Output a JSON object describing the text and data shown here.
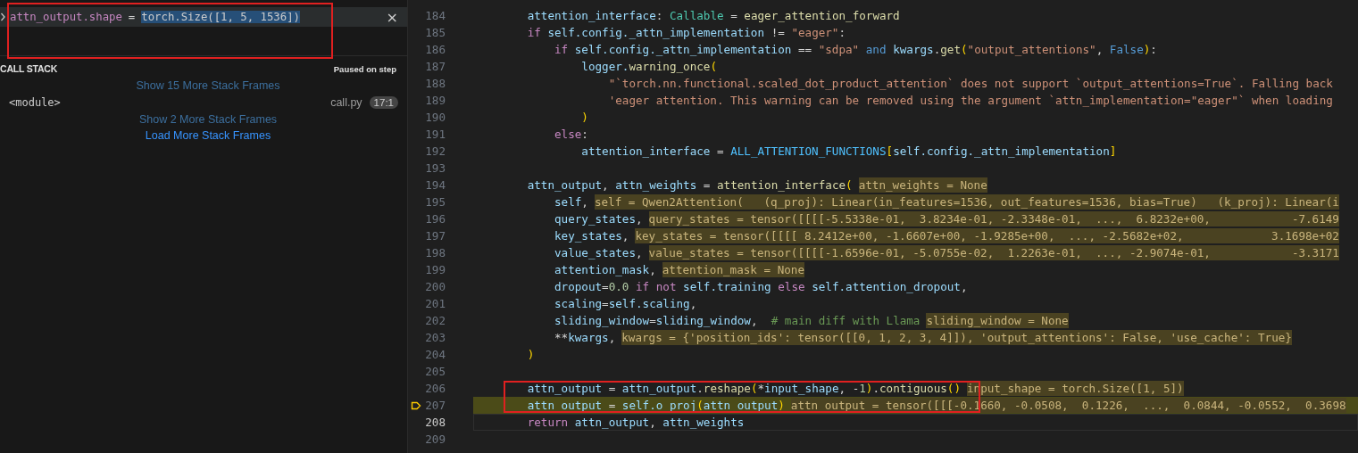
{
  "watch": {
    "expression": "attn_output.shape",
    "operator": "=",
    "value": "torch.Size([1, 5, 1536])",
    "close": "×"
  },
  "call_stack": {
    "title": "CALL STACK",
    "status": "Paused on step",
    "items": [
      {
        "kind": "link",
        "text": "Show 15 More Stack Frames"
      },
      {
        "kind": "frame",
        "name": "<module>",
        "file": "call.py",
        "position": "17:1"
      },
      {
        "kind": "link",
        "text": "Show 2 More Stack Frames"
      },
      {
        "kind": "action",
        "text": "Load More Stack Frames"
      }
    ]
  },
  "editor": {
    "lines": [
      {
        "number": "184",
        "stopped": false,
        "cursor": false,
        "tokens": [
          {
            "kind": "var",
            "text": "        attention_interface"
          },
          {
            "kind": "punct",
            "text": ":"
          },
          {
            "kind": "type",
            "text": " Callable"
          },
          {
            "kind": "punct",
            "text": " ="
          },
          {
            "kind": "func",
            "text": " eager_attention_forward"
          }
        ]
      },
      {
        "number": "185",
        "stopped": false,
        "cursor": false,
        "tokens": [
          {
            "kind": "keyword",
            "text": "        if"
          },
          {
            "kind": "var",
            "text": " self.config._attn_implementation"
          },
          {
            "kind": "punct",
            "text": " !="
          },
          {
            "kind": "string",
            "text": " \"eager\""
          },
          {
            "kind": "punct",
            "text": ":"
          }
        ]
      },
      {
        "number": "186",
        "stopped": false,
        "cursor": false,
        "tokens": [
          {
            "kind": "keyword",
            "text": "            if"
          },
          {
            "kind": "var",
            "text": " self.config._attn_implementation"
          },
          {
            "kind": "punct",
            "text": " =="
          },
          {
            "kind": "string",
            "text": " \"sdpa\""
          },
          {
            "kind": "const",
            "text": " and"
          },
          {
            "kind": "var",
            "text": " kwargs"
          },
          {
            "kind": "punct",
            "text": "."
          },
          {
            "kind": "func",
            "text": "get"
          },
          {
            "kind": "bracket",
            "text": "("
          },
          {
            "kind": "string",
            "text": "\"output_attentions\""
          },
          {
            "kind": "punct",
            "text": ","
          },
          {
            "kind": "const",
            "text": " False"
          },
          {
            "kind": "bracket",
            "text": ")"
          },
          {
            "kind": "punct",
            "text": ":"
          }
        ]
      },
      {
        "number": "187",
        "stopped": false,
        "cursor": false,
        "tokens": [
          {
            "kind": "var",
            "text": "                logger."
          },
          {
            "kind": "func",
            "text": "warning_once"
          },
          {
            "kind": "bracket",
            "text": "("
          }
        ]
      },
      {
        "number": "188",
        "stopped": false,
        "cursor": false,
        "tokens": [
          {
            "kind": "string",
            "text": "                    \"`torch.nn.functional.scaled_dot_product_attention` does not support `output_attentions=True`. Falling back"
          }
        ]
      },
      {
        "number": "189",
        "stopped": false,
        "cursor": false,
        "tokens": [
          {
            "kind": "string",
            "text": "                    'eager attention. This warning can be removed using the argument `attn_implementation=\"eager\"` when loading"
          }
        ]
      },
      {
        "number": "190",
        "stopped": false,
        "cursor": false,
        "tokens": [
          {
            "kind": "bracket",
            "text": "                )"
          }
        ]
      },
      {
        "number": "191",
        "stopped": false,
        "cursor": false,
        "tokens": [
          {
            "kind": "keyword",
            "text": "            else"
          },
          {
            "kind": "punct",
            "text": ":"
          }
        ]
      },
      {
        "number": "192",
        "stopped": false,
        "cursor": false,
        "tokens": [
          {
            "kind": "var",
            "text": "                attention_interface"
          },
          {
            "kind": "punct",
            "text": " ="
          },
          {
            "kind": "constant",
            "text": " ALL_ATTENTION_FUNCTIONS"
          },
          {
            "kind": "bracket",
            "text": "["
          },
          {
            "kind": "var",
            "text": "self.config._attn_implementation"
          },
          {
            "kind": "bracket",
            "text": "]"
          }
        ]
      },
      {
        "number": "193",
        "stopped": false,
        "cursor": false
      },
      {
        "number": "194",
        "stopped": false,
        "cursor": false,
        "tokens": [
          {
            "kind": "highlight",
            "text": "        attn_output"
          },
          {
            "kind": "punct",
            "text": ","
          },
          {
            "kind": "var",
            "text": " attn_weights"
          },
          {
            "kind": "punct",
            "text": " ="
          },
          {
            "kind": "func",
            "text": " attention_interface"
          },
          {
            "kind": "bracket",
            "text": "("
          }
        ],
        "inline": "attn_weights = None"
      },
      {
        "number": "195",
        "stopped": false,
        "cursor": false,
        "tokens": [
          {
            "kind": "var",
            "text": "            self"
          },
          {
            "kind": "punct",
            "text": ","
          }
        ],
        "inline": "self = Qwen2Attention(   (q_proj): Linear(in_features=1536, out_features=1536, bias=True)   (k_proj): Linear(i"
      },
      {
        "number": "196",
        "stopped": false,
        "cursor": false,
        "tokens": [
          {
            "kind": "var",
            "text": "            query_states"
          },
          {
            "kind": "punct",
            "text": ","
          }
        ],
        "inline": "query_states = tensor([[[[-5.5338e-01,  3.8234e-01, -2.3348e-01,  ...,  6.8232e+00,            -7.6149"
      },
      {
        "number": "197",
        "stopped": false,
        "cursor": false,
        "tokens": [
          {
            "kind": "var",
            "text": "            key_states"
          },
          {
            "kind": "punct",
            "text": ","
          }
        ],
        "inline": "key_states = tensor([[[[ 8.2412e+00, -1.6607e+00, -1.9285e+00,  ..., -2.5682e+02,             3.1698e+02"
      },
      {
        "number": "198",
        "stopped": false,
        "cursor": false,
        "tokens": [
          {
            "kind": "var",
            "text": "            value_states"
          },
          {
            "kind": "punct",
            "text": ","
          }
        ],
        "inline": "value_states = tensor([[[[-1.6596e-01, -5.0755e-02,  1.2263e-01,  ..., -2.9074e-01,            -3.3171"
      },
      {
        "number": "199",
        "stopped": false,
        "cursor": false,
        "tokens": [
          {
            "kind": "var",
            "text": "            attention_mask"
          },
          {
            "kind": "punct",
            "text": ","
          }
        ],
        "inline": "attention_mask = None"
      },
      {
        "number": "200",
        "stopped": false,
        "cursor": false,
        "tokens": [
          {
            "kind": "var",
            "text": "            dropout"
          },
          {
            "kind": "punct",
            "text": "="
          },
          {
            "kind": "number",
            "text": "0.0"
          },
          {
            "kind": "keyword",
            "text": " if not"
          },
          {
            "kind": "var",
            "text": " self.training"
          },
          {
            "kind": "keyword",
            "text": " else"
          },
          {
            "kind": "var",
            "text": " self.attention_dropout"
          },
          {
            "kind": "punct",
            "text": ","
          }
        ]
      },
      {
        "number": "201",
        "stopped": false,
        "cursor": false,
        "tokens": [
          {
            "kind": "var",
            "text": "            scaling"
          },
          {
            "kind": "punct",
            "text": "="
          },
          {
            "kind": "var",
            "text": "self.scaling"
          },
          {
            "kind": "punct",
            "text": ","
          }
        ]
      },
      {
        "number": "202",
        "stopped": false,
        "cursor": false,
        "tokens": [
          {
            "kind": "var",
            "text": "            sliding_window"
          },
          {
            "kind": "punct",
            "text": "="
          },
          {
            "kind": "var",
            "text": "sliding_window"
          },
          {
            "kind": "punct",
            "text": ","
          },
          {
            "kind": "comment",
            "text": "  # main diff with Llama"
          }
        ],
        "inline": "sliding_window = None"
      },
      {
        "number": "203",
        "stopped": false,
        "cursor": false,
        "tokens": [
          {
            "kind": "punct",
            "text": "            **"
          },
          {
            "kind": "var",
            "text": "kwargs"
          },
          {
            "kind": "punct",
            "text": ","
          }
        ],
        "inline": "kwargs = {'position_ids': tensor([[0, 1, 2, 3, 4]]), 'output_attentions': False, 'use_cache': True}"
      },
      {
        "number": "204",
        "stopped": false,
        "cursor": false,
        "tokens": [
          {
            "kind": "bracket",
            "text": "        )"
          }
        ]
      },
      {
        "number": "205",
        "stopped": false,
        "cursor": false
      },
      {
        "number": "206",
        "stopped": false,
        "cursor": false,
        "tokens": [
          {
            "kind": "highlight",
            "text": "        attn_output"
          },
          {
            "kind": "punct",
            "text": " ="
          },
          {
            "kind": "highlight",
            "text": " attn_output"
          },
          {
            "kind": "punct",
            "text": "."
          },
          {
            "kind": "func",
            "text": "reshape"
          },
          {
            "kind": "bracket",
            "text": "("
          },
          {
            "kind": "punct",
            "text": "*"
          },
          {
            "kind": "var",
            "text": "input_shape"
          },
          {
            "kind": "punct",
            "text": ", -"
          },
          {
            "kind": "number",
            "text": "1"
          },
          {
            "kind": "bracket",
            "text": ")"
          },
          {
            "kind": "punct",
            "text": "."
          },
          {
            "kind": "func",
            "text": "contiguous"
          },
          {
            "kind": "bracket",
            "text": "()"
          }
        ],
        "inline": "input_shape = torch.Size([1, 5])"
      },
      {
        "number": "207",
        "stopped": true,
        "cursor": false,
        "tokens": [
          {
            "kind": "highlight",
            "text": "        attn_output"
          },
          {
            "kind": "punct",
            "text": " ="
          },
          {
            "kind": "var",
            "text": " self.o_proj"
          },
          {
            "kind": "bracket",
            "text": "("
          },
          {
            "kind": "highlight",
            "text": "attn_output"
          },
          {
            "kind": "bracket",
            "text": ")"
          }
        ],
        "inline": "attn_output = tensor([[[-0.1660, -0.0508,  0.1226,  ...,  0.0844, -0.0552,  0.3698"
      },
      {
        "number": "208",
        "stopped": false,
        "cursor": true,
        "tokens": [
          {
            "kind": "keyword",
            "text": "        return"
          },
          {
            "kind": "highlight",
            "text": " attn_output"
          },
          {
            "kind": "punct",
            "text": ","
          },
          {
            "kind": "var",
            "text": " attn_weights"
          }
        ]
      },
      {
        "number": "209",
        "stopped": false,
        "cursor": false
      }
    ]
  }
}
